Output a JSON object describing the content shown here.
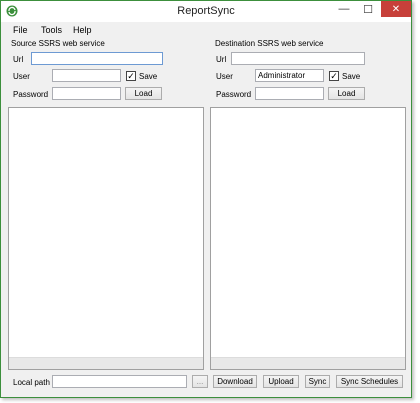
{
  "window": {
    "title": "ReportSync",
    "minimize_glyph": "—",
    "maximize_glyph": "☐",
    "close_glyph": "✕",
    "app_icon": "sync-app-icon",
    "accent": "#3c8f3c"
  },
  "menu": {
    "file": "File",
    "tools": "Tools",
    "help": "Help"
  },
  "source": {
    "group_title": "Source SSRS web service",
    "url_label": "Url",
    "url_value": "",
    "user_label": "User",
    "user_value": "",
    "save_label": "Save",
    "save_checked": "✓",
    "password_label": "Password",
    "password_value": "",
    "load_label": "Load"
  },
  "destination": {
    "group_title": "Destination SSRS web service",
    "url_label": "Url",
    "url_value": "",
    "user_label": "User",
    "user_value": "Administrator",
    "save_label": "Save",
    "save_checked": "✓",
    "password_label": "Password",
    "password_value": "",
    "load_label": "Load"
  },
  "bottom": {
    "local_path_label": "Local path",
    "local_path_value": "",
    "browse_label": "...",
    "download_label": "Download",
    "upload_label": "Upload",
    "sync_label": "Sync",
    "sync_schedules_label": "Sync Schedules"
  }
}
